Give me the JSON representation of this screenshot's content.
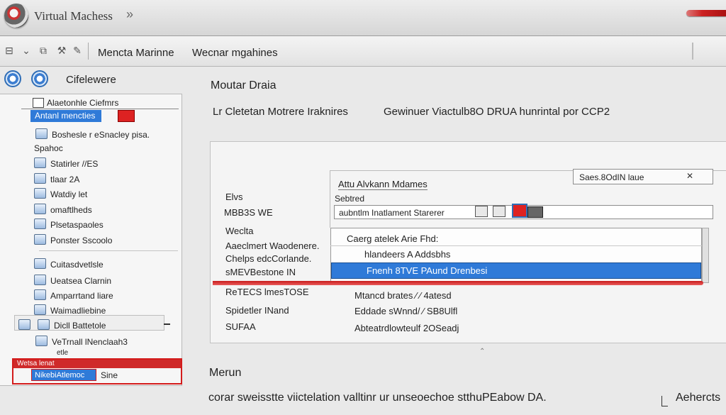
{
  "window": {
    "title": "Virtual Machess",
    "chevron": "»"
  },
  "toolbar": {
    "tabs": [
      "Mencta Marinne",
      "Wecnar mgahines"
    ]
  },
  "sidebar": {
    "title": "Cifelewere",
    "top_item": "Alaetonhle Ciefmrs",
    "highlighted_item": "Antanl mencties",
    "items": [
      "Boshesle r eSnacley pisa.",
      "Spahoc",
      "Statirler //ES",
      "tlaar 2A",
      "Watdiy let",
      "omaftlheds",
      "Plsetaspaoles",
      "Ponster Sscoolo",
      "Cuitasdvetlsle",
      "Ueatsea Clarnin",
      "Amparrtand liare",
      "Waimadliebine",
      "Dicll Battetole",
      "VeTrnall lNenclaah3",
      "etle",
      "NikebiAtlemoc"
    ],
    "selected_item": "Wetsa lenat",
    "selected_tail": "Sine"
  },
  "main": {
    "heading": "Moutar Draia",
    "subheading_left": "Lr  Cletetan Motrere Iraknires",
    "subheading_right": "Gewinuer Viactulb8O DRUA hunrintal por CCP2",
    "labels": [
      "Elvs",
      "MBB3S WE",
      "Weclta",
      "Aaeclmert Waodenere.",
      "Chelps edcCorlande.",
      "sMEVBestone IN",
      "ReTECS lmesTOSE",
      "Spidetler INand",
      "SUFAA"
    ],
    "form_title": "Attu Alvkann Mdames",
    "form_label": "Sebtred",
    "name_value": "aubntlm Inatlament Starerer",
    "search_value": "Saes.8OdIN laue",
    "dropdown_items": [
      "Caerg atelek Arie Fhd:",
      "hlandeers  A Addsbhs",
      "Fnenh 8TVE PAund Drenbesi"
    ],
    "details": [
      "Mtancd brates ⁄ ⁄ 4atesd",
      "Eddade sWnnd/ ⁄ SB8Ulfl",
      "Abteatrdlowteulf 2OSeadj"
    ]
  },
  "footer": {
    "heading": "Merun",
    "text": "corar sweisstte viictelation valltinr ur unseoechoe stthuPEabow DA.",
    "link": "Aehercts"
  }
}
